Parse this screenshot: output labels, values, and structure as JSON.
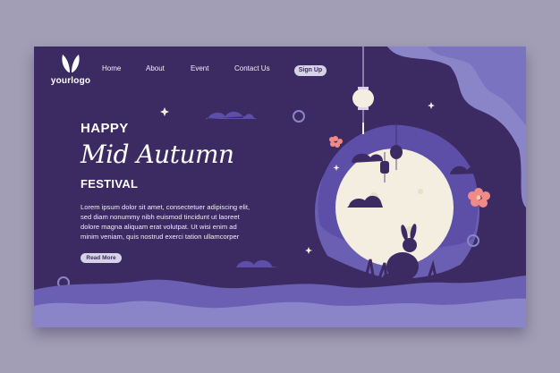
{
  "brand": {
    "logo_text": "yourlogo",
    "logo_icon": "bunny-ears-icon"
  },
  "nav": {
    "items": [
      {
        "label": "Home"
      },
      {
        "label": "About"
      },
      {
        "label": "Event"
      },
      {
        "label": "Contact Us"
      }
    ],
    "signup_label": "Sign Up"
  },
  "hero": {
    "kicker": "HAPPY",
    "title": "Mid Autumn",
    "subtitle": "FESTIVAL",
    "body_lines": [
      "Lorem ipsum dolor sit amet, consectetuer adipiscing elit,",
      "sed diam nonummy nibh euismod tincidunt ut laoreet",
      "dolore magna aliquam erat volutpat. Ut wisi enim ad",
      "minim veniam, quis nostrud exerci tation ullamcorper"
    ],
    "button_label": "Read More"
  },
  "colors": {
    "page_bg": "#a29eb6",
    "card_bg": "#3c2a63",
    "wave_light": "#8a84c9",
    "wave_mid": "#6a5fb3",
    "moon": "#f3eee0",
    "flower": "#f08a86"
  },
  "illustration": {
    "icons": [
      "paper-lantern-icon",
      "full-moon-icon",
      "rabbit-silhouette-icon",
      "cloud-icon",
      "star-icon",
      "flower-icon"
    ]
  }
}
